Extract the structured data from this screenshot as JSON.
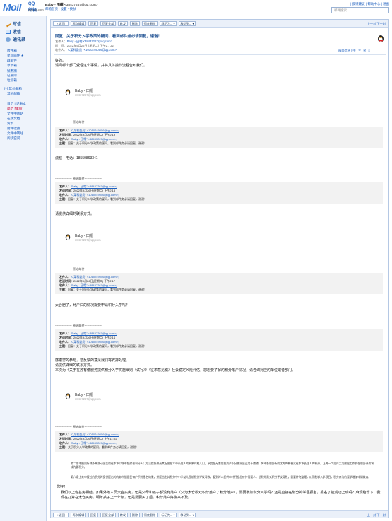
{
  "brand": {
    "logo": "Moil",
    "qq": "QQ邮箱",
    "domain": "mail.qq.com"
  },
  "header": {
    "user_name": "Baby - 田帽",
    "user_email": "<38437267@qq.com>",
    "user_links": "邮箱首页 | 设置 - 换肤",
    "top_links": "| 反馈建议 | 帮助中心 | 退出",
    "search_placeholder": "邮件搜索"
  },
  "sidebar": {
    "write": "写信",
    "receive": "收信",
    "contacts": "通讯录",
    "folders": [
      "收件箱",
      "星标邮件 ★",
      "群邮件",
      "草稿箱",
      "已发送",
      "已删除",
      "垃圾箱"
    ],
    "other_title": "[+] 其他邮箱",
    "other2": "其他邮箱",
    "extras": [
      "日历 | 记事本",
      "简历 NEW",
      "文件中转站",
      "在线文档",
      "贺卡",
      "附件收藏",
      "文件中转站",
      "阅读空间"
    ]
  },
  "toolbar": {
    "buttons": [
      "« 返回",
      "再次编辑",
      "回复",
      "回复全部",
      "转发",
      "删除",
      "彻底删除",
      "标记为... ▾",
      "移动到... ▾"
    ],
    "nav": "上一封 下一封"
  },
  "mail": {
    "subject": "回复：关于积分入学政策的疑问，看到邮件务必请回复，谢谢！",
    "sender_label": "发件人：",
    "sender": "Baby - 田帽 <38437267@qq.com>",
    "time_label": "时　间：",
    "time": "2022年9月26日 (星期二) 下午2：22",
    "to_label": "收件人：",
    "to": "\"C某科委员\" <1010249056@qq.com>",
    "tools": "精简信息 | 中 | 三 | ✉ | □"
  },
  "blocks": {
    "greeting": "好的。",
    "line2": "请问哪个部门受理这个事情，并将具体操作流程告知我们。",
    "sig_name": "Baby - 田帽",
    "sig_mail": "38437267@qq.com",
    "orig": "----------------- 原始邮件 -----------------",
    "q1": [
      [
        "发件人：",
        "\"C某科委员\" <1010249056@qq.com>;"
      ],
      [
        "发送时间：",
        "2022年9月26日(星期二) 下午2:19"
      ],
      [
        "收件人：",
        "\"Baby - 田帽\" <38437267@qq.com>;"
      ],
      [
        "主题：",
        "回复：关于积分入学政策的疑问，看到邮件务必请回复，谢谢！"
      ]
    ],
    "phone": "流程　电话：18550863341",
    "q2": [
      [
        "发件人：",
        "\"Baby - 田帽\" <38437267@qq.com>;"
      ],
      [
        "发送时间：",
        "2022年9月26日(星期二) 下午2:18"
      ],
      [
        "收件人：",
        "\"C某科委员\" <1010249056@qq.com>;"
      ],
      [
        "主题：",
        "回复：关于积分入学政策的疑问，看到邮件务必请回复，谢谢！"
      ]
    ],
    "ask2": "请提供详细的联系方式。",
    "q3": [
      [
        "发件人：",
        "\"C某科委员\" <1010249056@qq.com>;"
      ],
      [
        "发送时间：",
        "2022年9月26日(星期二) 下午2:17"
      ],
      [
        "收件人：",
        "\"Baby - 田帽\" <38437267@qq.com>;"
      ],
      [
        "主题：",
        "回复：关于积分入学政策的疑问，看到邮件务必请回复，谢谢！"
      ]
    ],
    "ask3": "太合肥了，允户口的情况需要申请积分入学吗？",
    "q4": [
      [
        "发件人：",
        "\"Baby - 田帽\" <38437267@qq.com>;"
      ],
      [
        "发送时间：",
        "2022年9月26日(星期二) 下午2:14"
      ],
      [
        "收件人：",
        "\"C某科委员\" <1010249056@qq.com>;"
      ],
      [
        "主题：",
        "回复：关于积分入学政策的疑问，看到邮件务必请回复，谢谢！"
      ]
    ],
    "p1": "感谢您的参与，您反馈的意见我们将安排处理。",
    "p2": "请提供详细的联系方式。",
    "p3": "本次为《关于在苏有偿服务提供积分入学实施细则（试行）》（征求意见稿）社会稳定风险评估，您想要了解的积分落户情况，请咨询对应的单位或者部门。",
    "q5": [
      [
        "发件人：",
        "\"C某科委员\" <1010249056@qq.com>;"
      ],
      [
        "发送时间：",
        "2022年9月26日(星期二) 上午11:31"
      ],
      [
        "收件人：",
        "\"Baby - 田帽\" <38437267@qq.com>;"
      ],
      [
        "主题：",
        "关于积分入学政策的疑问，看到邮件务必请回复，谢谢！"
      ]
    ],
    "small1": "第二条本细则所称外来流动出生的在本市以城市镇综合积分入门方法提升并亮其配合在本市长住人的未来户籍入门，享受在无差需量资产积分那家庭适用于随随，将市各积分新的优秀的新模式在本市长住人的积分，让每一个流户大为数据工作到在积分评务将成为要积分。",
    "small2": "第六条上来申报过的积分将提供提出的的城市镇居民每户积分报名结果，并提出出其积分中小学幼儿园前积分评议导致，看到将人提供审计行程总价外需要人，总则外需式积分评议导致，需要补充整理，从而能够入学项目，积分办法的要求增加申请教育。",
    "hello": "您好！",
    "final": "我们以上班基务相结，如果外地人员太合买房，但是父母和孩子都没有落户（父为太仓模双积分落户了积分落户），需要参加积分入学吗？还是直接在划分的学区报名，报名了能成功上成吗？麻烦给帮下，我现在打算在太仓买房，明年孩子上一年级，但是需要买了后，积分落户好像来不及。"
  }
}
